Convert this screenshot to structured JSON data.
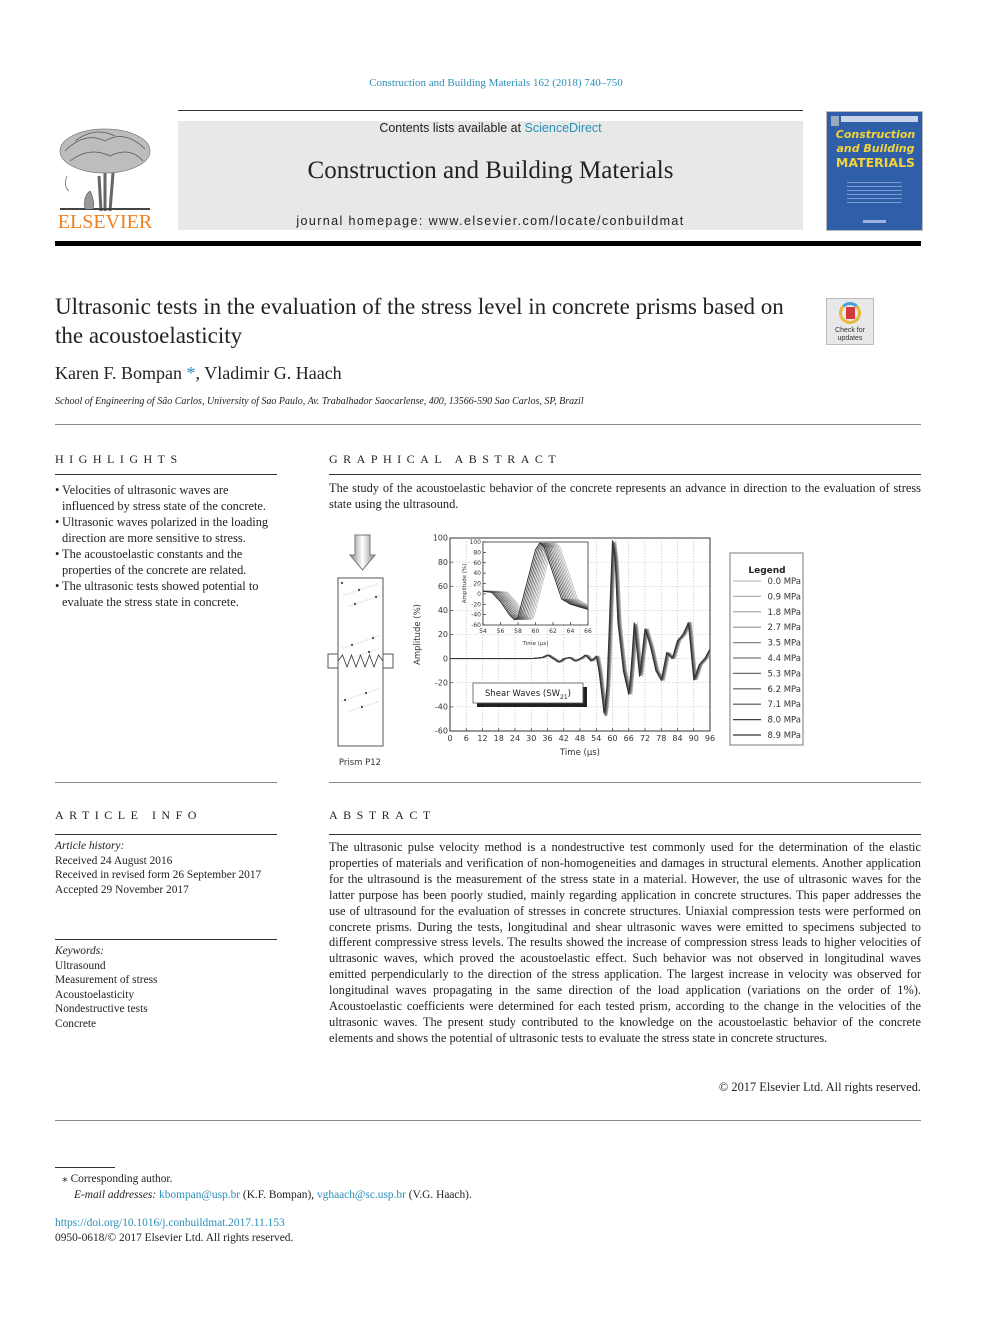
{
  "header": {
    "journal_reference": "Construction and Building Materials 162 (2018) 740–750",
    "contents_prefix": "Contents lists available at ",
    "contents_link": "ScienceDirect",
    "journal_title": "Construction and Building Materials",
    "homepage": "journal homepage: www.elsevier.com/locate/conbuildmat",
    "publisher_logo_text": "ELSEVIER",
    "cover": {
      "line1": "Construction",
      "line2": "and Building",
      "line3": "MATERIALS"
    },
    "crossmark": "Check for updates"
  },
  "article": {
    "title": "Ultrasonic tests in the evaluation of the stress level in concrete prisms based on the acoustoelasticity",
    "authors": [
      {
        "name": "Karen F. Bompan",
        "mark": "*"
      },
      {
        "name": "Vladimir G. Haach",
        "mark": ""
      }
    ],
    "author_separator": ", ",
    "affiliation": "School of Engineering of São Carlos, University of Sao Paulo, Av. Trabalhador Saocarlense, 400, 13566-590 Sao Carlos, SP, Brazil"
  },
  "highlights": {
    "heading": "HIGHLIGHTS",
    "items": [
      "Velocities of ultrasonic waves are influenced by stress state of the concrete.",
      "Ultrasonic waves polarized in the loading direction are more sensitive to stress.",
      "The acoustoelastic constants and the properties of the concrete are related.",
      "The ultrasonic tests showed potential to evaluate the stress state in concrete."
    ]
  },
  "graphical_abstract": {
    "heading": "GRAPHICAL ABSTRACT",
    "text": "The study of the acoustoelastic behavior of the concrete represents an advance in direction to the evaluation of stress state using the ultrasound.",
    "prism_label": "Prism P12"
  },
  "chart_data": [
    {
      "type": "line",
      "title": "",
      "annotation": "Shear Waves (SW21)",
      "annotation_main": "Shear Waves (SW",
      "annotation_sub": "21",
      "annotation_end": ")",
      "xlabel": "Time (µs)",
      "ylabel": "Amplitude (%)",
      "xlim": [
        0,
        96
      ],
      "ylim": [
        -60,
        100
      ],
      "x_ticks": [
        0,
        6,
        12,
        18,
        24,
        30,
        36,
        42,
        48,
        54,
        60,
        66,
        72,
        78,
        84,
        90,
        96
      ],
      "y_ticks": [
        -60,
        -40,
        -20,
        0,
        20,
        40,
        60,
        80,
        100
      ],
      "grid": true,
      "legend_title": "Legend",
      "legend_position": "right-outside",
      "series_names": [
        "0.0 MPa",
        "0.9 MPa",
        "1.8 MPa",
        "2.7 MPa",
        "3.5 MPa",
        "4.4 MPa",
        "5.3 MPa",
        "6.2 MPa",
        "7.1 MPa",
        "8.0 MPa",
        "8.9 MPa"
      ],
      "reference_series": {
        "name": "8.9 MPa",
        "x": [
          0,
          30,
          34,
          36,
          38,
          40,
          42,
          44,
          46,
          48,
          50,
          52,
          54,
          55,
          57,
          58,
          60,
          61,
          62,
          64,
          66,
          67,
          68,
          70,
          72,
          74,
          76,
          78,
          80,
          82,
          84,
          86,
          88,
          90,
          92,
          94,
          96
        ],
        "y": [
          0,
          0,
          1,
          3,
          0,
          -3,
          0,
          1,
          -2,
          0,
          3,
          -2,
          2,
          -10,
          -48,
          -20,
          98,
          80,
          30,
          -10,
          -30,
          -5,
          30,
          -15,
          25,
          10,
          -10,
          -18,
          5,
          0,
          15,
          20,
          30,
          -18,
          -5,
          0,
          8
        ]
      },
      "series_shift_per_step_us": 0.12
    },
    {
      "type": "line",
      "title": "inset",
      "xlabel": "Time (µs)",
      "ylabel": "Amplitude (%)",
      "xlim": [
        54,
        66
      ],
      "ylim": [
        -60,
        100
      ],
      "x_ticks": [
        54,
        56,
        58,
        60,
        62,
        64,
        66
      ],
      "y_ticks": [
        -60,
        -40,
        -20,
        0,
        20,
        40,
        60,
        80,
        100
      ],
      "grid": false,
      "reference_series": {
        "name": "8.9 MPa",
        "x": [
          54,
          55,
          56,
          57,
          57.6,
          58,
          59,
          60,
          60.5,
          61,
          62,
          63,
          64,
          65,
          66
        ],
        "y": [
          5,
          3,
          -15,
          -40,
          -50,
          -45,
          20,
          85,
          98,
          90,
          40,
          -10,
          -20,
          -25,
          -30
        ]
      },
      "series_shift_per_step_us": 0.18
    }
  ],
  "article_info": {
    "heading": "ARTICLE INFO",
    "history_label": "Article history:",
    "history": [
      "Received 24 August 2016",
      "Received in revised form 26 September 2017",
      "Accepted 29 November 2017"
    ],
    "keywords_label": "Keywords:",
    "keywords": [
      "Ultrasound",
      "Measurement of stress",
      "Acoustoelasticity",
      "Nondestructive tests",
      "Concrete"
    ]
  },
  "abstract": {
    "heading": "ABSTRACT",
    "text": "The ultrasonic pulse velocity method is a nondestructive test commonly used for the determination of the elastic properties of materials and verification of non-homogeneities and damages in structural elements. Another application for the ultrasound is the measurement of the stress state in a material. However, the use of ultrasonic waves for the latter purpose has been poorly studied, mainly regarding application in concrete structures. This paper addresses the use of ultrasound for the evaluation of stresses in concrete structures. Uniaxial compression tests were performed on concrete prisms. During the tests, longitudinal and shear ultrasonic waves were emitted to specimens subjected to different compressive stress levels. The results showed the increase of compression stress leads to higher velocities of ultrasonic waves, which proved the acoustoelastic effect. Such behavior was not observed in longitudinal waves emitted perpendicularly to the direction of the stress application. The largest increase in velocity was observed for longitudinal waves propagating in the same direction of the load application (variations on the order of 1%). Acoustoelastic coefficients were determined for each tested prism, according to the change in the velocities of the ultrasonic waves. The present study contributed to the knowledge on the acoustoelastic behavior of the concrete elements and shows the potential of ultrasonic tests to evaluate the stress state in concrete structures.",
    "copyright": "© 2017 Elsevier Ltd. All rights reserved."
  },
  "footnote": {
    "mark": "⁎",
    "corresponding": "Corresponding author.",
    "email_label": "E-mail addresses:",
    "email1": "kbompan@usp.br",
    "email1_owner": " (K.F. Bompan), ",
    "email2": "vghaach@sc.usp.br",
    "email2_owner": " (V.G. Haach)."
  },
  "doi": {
    "url": "https://doi.org/10.1016/j.conbuildmat.2017.11.153",
    "issn_line": "0950-0618/© 2017 Elsevier Ltd. All rights reserved."
  },
  "colors": {
    "link": "#2a8fb8",
    "elsevier_orange": "#f07f20",
    "cover_blue": "#2f5fa8",
    "cover_yellow": "#f4d43a"
  }
}
